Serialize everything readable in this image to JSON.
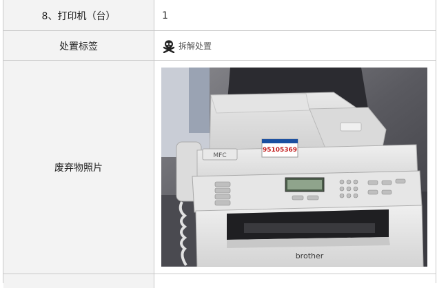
{
  "rows": [
    {
      "label": "8、打印机（台）",
      "value": "1"
    },
    {
      "label": "处置标签",
      "tag_text": "拆解处置",
      "tag_icon": "skull-crossbones-icon"
    },
    {
      "label": "废弃物照片",
      "photo": {
        "sticker_text": "95105369",
        "panel_logo": "MFC",
        "brand": "brother"
      }
    }
  ]
}
